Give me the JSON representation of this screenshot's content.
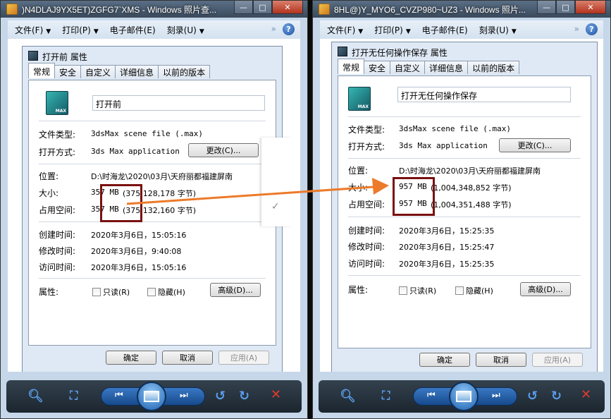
{
  "viewer_left": {
    "window_title": ")N4DLAJ9YX5ET)ZGFG7`XMS - Windows 照片查...",
    "menu": [
      "文件(F)",
      "打印(P)",
      "电子邮件(E)",
      "刻录(U)"
    ],
    "dialog": {
      "title": "打开前 属性",
      "tabs": [
        "常规",
        "安全",
        "自定义",
        "详细信息",
        "以前的版本"
      ],
      "file_name": "打开前",
      "file_type_label": "文件类型:",
      "file_type_value": "3dsMax scene file (.max)",
      "open_with_label": "打开方式:",
      "open_with_value": "3ds Max application",
      "change_button": "更改(C)...",
      "location_label": "位置:",
      "location_value": "D:\\时海龙\\2020\\03月\\天府丽都福建屏南",
      "size_label": "大小:",
      "size_mb": "357 MB",
      "size_bytes": "(375,128,178 字节)",
      "size_on_disk_label": "占用空间:",
      "size_on_disk_mb": "357 MB",
      "size_on_disk_bytes": "(375,132,160 字节)",
      "created_label": "创建时间:",
      "created_value": "2020年3月6日，15:05:16",
      "modified_label": "修改时间:",
      "modified_value": "2020年3月6日，9:40:08",
      "accessed_label": "访问时间:",
      "accessed_value": "2020年3月6日，15:05:16",
      "attributes_label": "属性:",
      "readonly_label": "只读(R)",
      "hidden_label": "隐藏(H)",
      "advanced_button": "高级(D)...",
      "ok_button": "确定",
      "cancel_button": "取消",
      "apply_button": "应用(A)"
    }
  },
  "viewer_right": {
    "window_title": "8HL@)Y_MYO6_CVZP980~UZ3 - Windows 照片...",
    "menu": [
      "文件(F)",
      "打印(P)",
      "电子邮件(E)",
      "刻录(U)"
    ],
    "dialog": {
      "title": "打开无任何操作保存 属性",
      "tabs": [
        "常规",
        "安全",
        "自定义",
        "详细信息",
        "以前的版本"
      ],
      "file_name": "打开无任何操作保存",
      "file_type_label": "文件类型:",
      "file_type_value": "3dsMax scene file (.max)",
      "open_with_label": "打开方式:",
      "open_with_value": "3ds Max application",
      "change_button": "更改(C)...",
      "location_label": "位置:",
      "location_value": "D:\\时海龙\\2020\\03月\\天府丽都福建屏南",
      "size_label": "大小:",
      "size_mb": "957 MB",
      "size_bytes": "(1,004,348,852 字节)",
      "size_on_disk_label": "占用空间:",
      "size_on_disk_mb": "957 MB",
      "size_on_disk_bytes": "(1,004,351,488 字节)",
      "created_label": "创建时间:",
      "created_value": "2020年3月6日，15:25:35",
      "modified_label": "修改时间:",
      "modified_value": "2020年3月6日，15:25:47",
      "accessed_label": "访问时间:",
      "accessed_value": "2020年3月6日，15:25:35",
      "attributes_label": "属性:",
      "readonly_label": "只读(R)",
      "hidden_label": "隐藏(H)",
      "advanced_button": "高级(D)...",
      "ok_button": "确定",
      "cancel_button": "取消",
      "apply_button": "应用(A)"
    }
  },
  "colors": {
    "highlight_box": "#7a1010",
    "arrow": "#ec7a2a",
    "close_button": "#b2321d"
  },
  "icons": [
    "minimize-icon",
    "maximize-icon",
    "close-icon",
    "help-icon",
    "max-file-icon",
    "zoom-icon",
    "fit-icon",
    "previous-icon",
    "slideshow-icon",
    "next-icon",
    "rotate-left-icon",
    "rotate-right-icon",
    "delete-icon"
  ]
}
